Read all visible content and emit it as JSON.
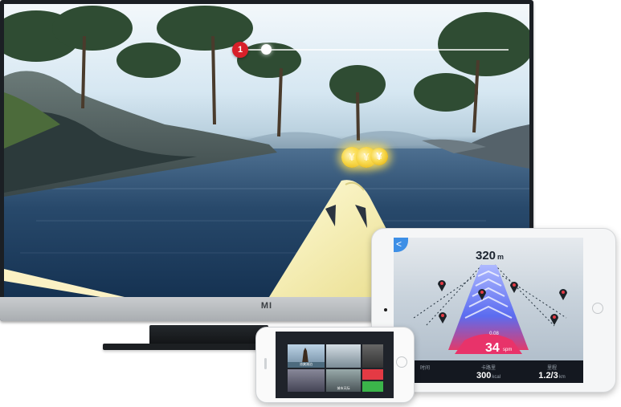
{
  "tv": {
    "brand_logo": "MI",
    "hud": {
      "rank": "1"
    },
    "coin_symbol": "¥"
  },
  "tablet": {
    "back_label": "<",
    "distance": {
      "value": "320",
      "unit": "m"
    },
    "stroke": {
      "rate": "0.08",
      "spm": "34",
      "spm_unit": "spm"
    },
    "stats": [
      {
        "label": "时间",
        "value": "",
        "unit": ""
      },
      {
        "label": "卡路里",
        "value": "300",
        "unit": "kcal"
      },
      {
        "label": "里程",
        "value": "1.2/3",
        "unit": "km"
      }
    ]
  },
  "phone": {
    "tiles": [
      {
        "label": "凉爽湖泊"
      },
      {
        "label": ""
      },
      {
        "label": ""
      },
      {
        "label": ""
      },
      {
        "label": "城市天际"
      },
      {
        "label": ""
      }
    ],
    "colors": {
      "accent_red": "#e43a44",
      "accent_green": "#3bb54a"
    }
  },
  "colors": {
    "hud_badge": "#d8202a",
    "lane": "#5b6cf0",
    "lane_end": "#e23a6a",
    "stats_bg": "#141820"
  }
}
